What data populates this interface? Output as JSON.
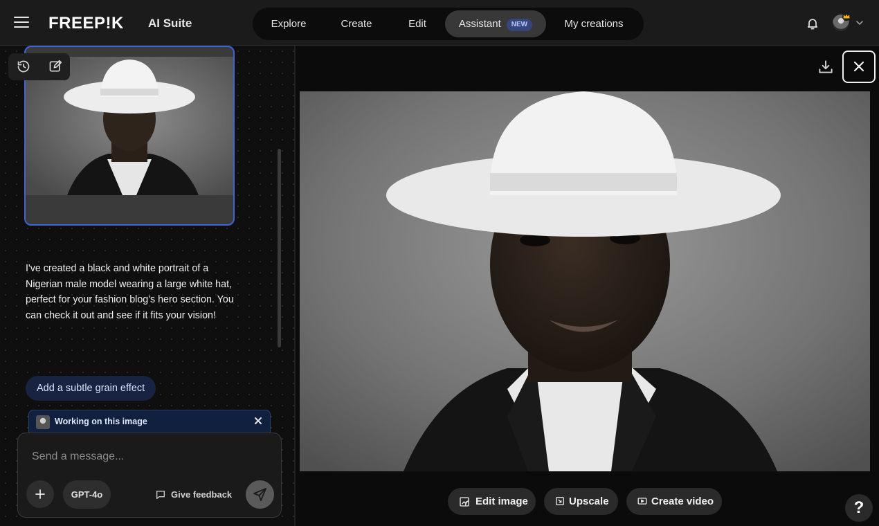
{
  "header": {
    "logo": "FREEP!K",
    "suite": "AI Suite",
    "nav": [
      {
        "label": "Explore"
      },
      {
        "label": "Create"
      },
      {
        "label": "Edit"
      },
      {
        "label": "Assistant",
        "badge": "NEW",
        "active": true
      },
      {
        "label": "My creations"
      }
    ],
    "icons": [
      "hamburger-icon",
      "bell-icon",
      "avatar",
      "crown-icon",
      "chevron-down-icon"
    ]
  },
  "left_panel": {
    "toolbar_icons": [
      "history-icon",
      "edit-icon"
    ],
    "assistant_message": "I've created a black and white portrait of a Nigerian male model wearing a large white hat, perfect for your fashion blog's hero section. You can check it out and see if it fits your vision!",
    "suggestion": "Add a subtle grain effect",
    "working_label": "Working on this image",
    "composer": {
      "placeholder": "Send a message...",
      "model": "GPT-4o",
      "feedback": "Give feedback"
    }
  },
  "right_panel": {
    "actions": [
      {
        "label": "Edit image",
        "icon": "edit-image-icon"
      },
      {
        "label": "Upscale",
        "icon": "upscale-icon"
      },
      {
        "label": "Create video",
        "icon": "video-icon"
      }
    ],
    "help": "?"
  },
  "colors": {
    "accent_border": "#3e64e0",
    "chip_bg": "#172340",
    "badge_bg": "#36457a"
  }
}
